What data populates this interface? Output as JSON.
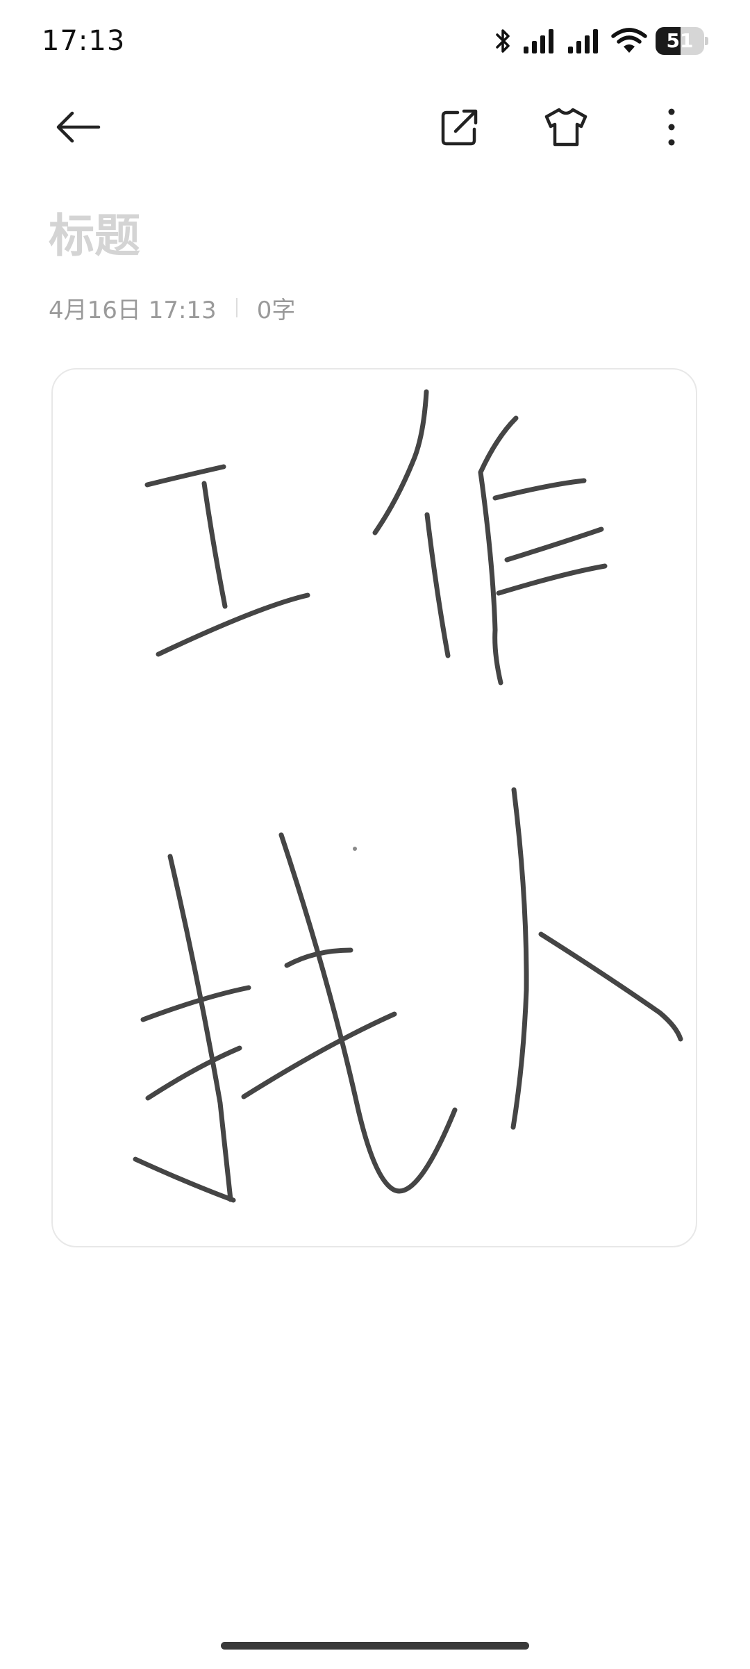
{
  "status_bar": {
    "time": "17:13",
    "battery_level": "51",
    "icons": [
      "bluetooth-icon",
      "signal-icon",
      "signal-icon",
      "wifi-icon",
      "battery-icon"
    ]
  },
  "toolbar": {
    "icons": [
      "arrow-left-icon",
      "share-external-icon",
      "tshirt-icon",
      "more-vertical-icon"
    ]
  },
  "note": {
    "title_placeholder": "标题",
    "date": "4月16日 17:13",
    "word_count": "0字",
    "handwriting": [
      "工作",
      "找人"
    ]
  },
  "colors": {
    "background": "#ffffff",
    "ink": "#454545",
    "title_placeholder": "#d4d4d4",
    "meta_text": "#9a9a9a",
    "card_border": "#e8e8e8"
  }
}
